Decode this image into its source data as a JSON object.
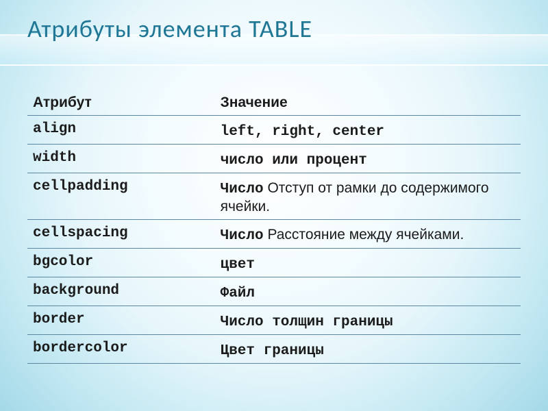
{
  "title": "Атрибуты элемента TABLE",
  "columns": {
    "attribute": "Атрибут",
    "value": "Значение"
  },
  "rows": [
    {
      "attr": "align",
      "mono": "left, right, center",
      "desc": ""
    },
    {
      "attr": "width",
      "mono": "число или процент",
      "desc": ""
    },
    {
      "attr": "cellpadding",
      "mono": "Число",
      "desc": " Отступ от рамки до содержимого ячейки."
    },
    {
      "attr": "cellspacing",
      "mono": "Число",
      "desc": " Расстояние между ячейками."
    },
    {
      "attr": "bgcolor",
      "mono": "цвет",
      "desc": ""
    },
    {
      "attr": "background",
      "mono": "Файл",
      "desc": ""
    },
    {
      "attr": "border",
      "mono": "Число толщин границы",
      "desc": ""
    },
    {
      "attr": "bordercolor",
      "mono": "Цвет границы",
      "desc": ""
    }
  ]
}
